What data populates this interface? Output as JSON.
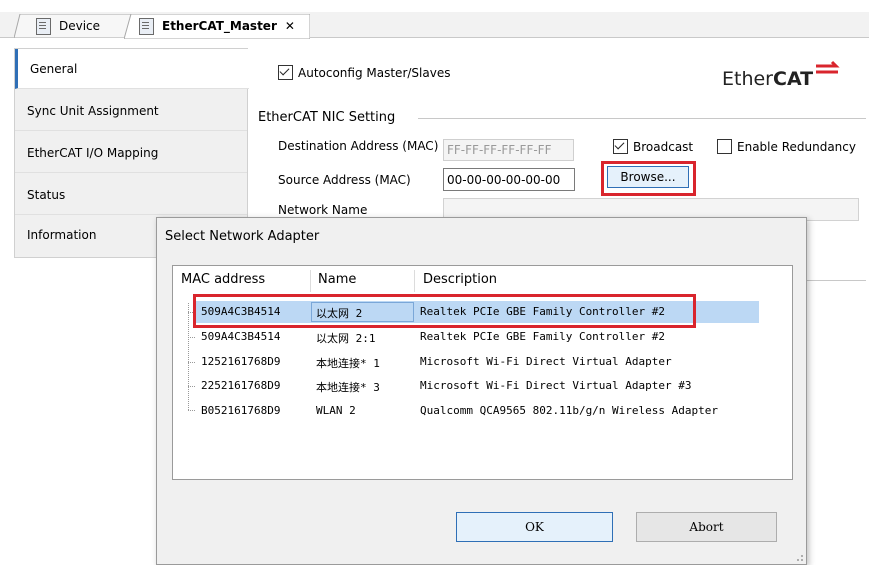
{
  "tabs": [
    {
      "label": "Device"
    },
    {
      "label": "EtherCAT_Master",
      "close": "✕"
    }
  ],
  "nav": {
    "items": [
      {
        "label": "General"
      },
      {
        "label": "Sync Unit Assignment"
      },
      {
        "label": "EtherCAT I/O Mapping"
      },
      {
        "label": "Status"
      },
      {
        "label": "Information"
      }
    ]
  },
  "general": {
    "autoconfig_label": "Autoconfig Master/Slaves",
    "logo_text_a": "Ether",
    "logo_text_b": "CAT",
    "nic_section": "EtherCAT NIC Setting",
    "dest_label": "Destination Address (MAC)",
    "dest_value": "FF-FF-FF-FF-FF-FF",
    "broadcast_label": "Broadcast",
    "redundancy_label": "Enable Redundancy",
    "source_label": "Source Address (MAC)",
    "source_value": "00-00-00-00-00-00",
    "browse_label": "Browse...",
    "network_label": "Network Name"
  },
  "dialog": {
    "title": "Select Network Adapter",
    "columns": [
      "MAC address",
      "Name",
      "Description"
    ],
    "rows": [
      {
        "mac": "509A4C3B4514",
        "name": "以太网 2",
        "desc": "Realtek PCIe GBE Family Controller #2"
      },
      {
        "mac": "509A4C3B4514",
        "name": "以太网 2:1",
        "desc": "Realtek PCIe GBE Family Controller #2"
      },
      {
        "mac": "1252161768D9",
        "name": "本地连接* 1",
        "desc": "Microsoft Wi-Fi Direct Virtual Adapter"
      },
      {
        "mac": "2252161768D9",
        "name": "本地连接* 3",
        "desc": "Microsoft Wi-Fi Direct Virtual Adapter #3"
      },
      {
        "mac": "B052161768D9",
        "name": "WLAN 2",
        "desc": "Qualcomm QCA9565 802.11b/g/n Wireless Adapter"
      }
    ],
    "ok_label": "OK",
    "abort_label": "Abort"
  },
  "colors": {
    "highlight": "#d9252d",
    "selected_row": "#bcd8f4",
    "accent": "#2f6fb6"
  }
}
